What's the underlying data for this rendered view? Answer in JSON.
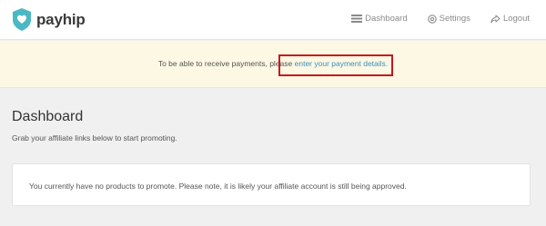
{
  "header": {
    "brand_name": "payhip",
    "brand_color": "#4bb9c4",
    "logo_icon": "heart-shield-icon",
    "nav": [
      {
        "label": "Dashboard",
        "icon": "hamburger-menu-icon"
      },
      {
        "label": "Settings",
        "icon": "gear-icon"
      },
      {
        "label": "Logout",
        "icon": "logout-arrow-icon"
      }
    ]
  },
  "notice": {
    "text_before": "To be able to receive payments, please ",
    "link_text": "enter your payment details.",
    "background_color": "#fcf8e3",
    "highlight_color": "#c8161d"
  },
  "main": {
    "title": "Dashboard",
    "subtitle": "Grab your affiliate links below to start promoting.",
    "empty_message": "You currently have no products to promote. Please note, it is likely your affiliate account is still being approved."
  }
}
